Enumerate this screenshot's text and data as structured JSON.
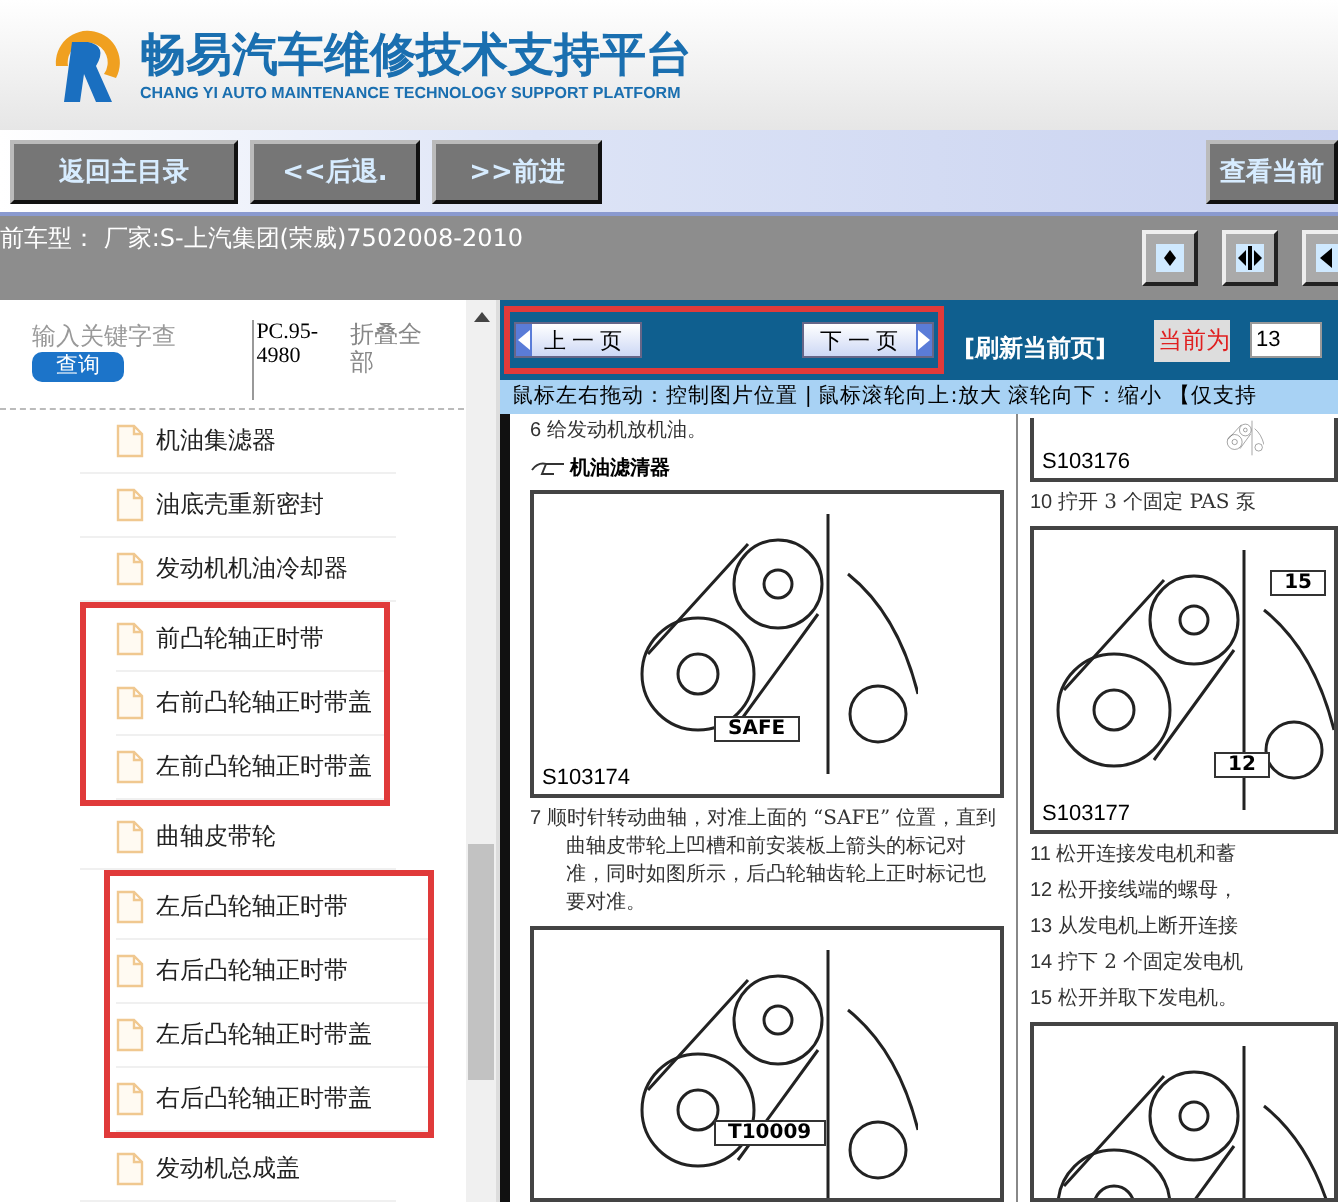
{
  "header": {
    "title": "畅易汽车维修技术支持平台",
    "subtitle": "CHANG YI AUTO MAINTENANCE TECHNOLOGY SUPPORT PLATFORM"
  },
  "nav_buttons": [
    {
      "label": "返回主目录"
    },
    {
      "label": "<<后退."
    },
    {
      "label": ">>前进"
    }
  ],
  "right_button": {
    "label": "查看当前"
  },
  "vehicle_bar": {
    "text": "前车型： 厂家:S-上汽集团(荣威)7502008-2010"
  },
  "sidebar": {
    "search": {
      "placeholder": "输入关键字查"
    },
    "search_button": "查询",
    "code": "PC.95-4980",
    "collapse": "折叠全部",
    "items": [
      {
        "label": "机油集滤器",
        "highlighted": false
      },
      {
        "label": "油底壳重新密封",
        "highlighted": false
      },
      {
        "label": "发动机机油冷却器",
        "highlighted": false
      },
      {
        "label": "前凸轮轴正时带",
        "highlighted": true
      },
      {
        "label": "右前凸轮轴正时带盖",
        "highlighted": true
      },
      {
        "label": "左前凸轮轴正时带盖",
        "highlighted": true
      },
      {
        "label": "曲轴皮带轮",
        "highlighted": false
      },
      {
        "label": "左后凸轮轴正时带",
        "highlighted": true
      },
      {
        "label": "右后凸轮轴正时带",
        "highlighted": true
      },
      {
        "label": "左后凸轮轴正时带盖",
        "highlighted": true
      },
      {
        "label": "右后凸轮轴正时带盖",
        "highlighted": true
      },
      {
        "label": "发动机总成盖",
        "highlighted": false
      }
    ]
  },
  "pager": {
    "highlighted": true,
    "prev": "上一页",
    "next": "下一页",
    "refresh": "[刷新当前页]",
    "current_label": "当前为",
    "current_value": "13"
  },
  "hint": "鼠标左右拖动：控制图片位置 | 鼠标滚轮向上:放大  滚轮向下：缩小 【仅支持",
  "document": {
    "columns": [
      [
        {
          "kind": "step",
          "number": "6",
          "text": "给发动机放机油。"
        },
        {
          "kind": "heading",
          "text": "机油滤清器"
        },
        {
          "kind": "figure",
          "caption": "S103174",
          "labels": [
            "SAFE"
          ]
        },
        {
          "kind": "step",
          "number": "7",
          "text": "顺时针转动曲轴，对准上面的 “SAFE” 位置，直到曲轴皮带轮上凹槽和前安装板上箭头的标记对准，同时如图所示，后凸轮轴齿轮上正时标记也要对准。"
        },
        {
          "kind": "figure",
          "labels": [
            "T10009"
          ]
        }
      ],
      [
        {
          "kind": "figure",
          "caption": "S103176"
        },
        {
          "kind": "step",
          "number": "10",
          "text": "拧开 3 个固定 PAS 泵"
        },
        {
          "kind": "figure",
          "caption": "S103177",
          "labels": [
            "12",
            "15"
          ]
        },
        {
          "kind": "step",
          "number": "11",
          "text": "松开连接发电机和蓄"
        },
        {
          "kind": "step",
          "number": "12",
          "text": "松开接线端的螺母，"
        },
        {
          "kind": "step",
          "number": "13",
          "text": "从发电机上断开连接"
        },
        {
          "kind": "step",
          "number": "14",
          "text": "拧下 2 个固定发电机"
        },
        {
          "kind": "step",
          "number": "15",
          "text": "松开并取下发电机。"
        },
        {
          "kind": "figure"
        }
      ]
    ]
  }
}
